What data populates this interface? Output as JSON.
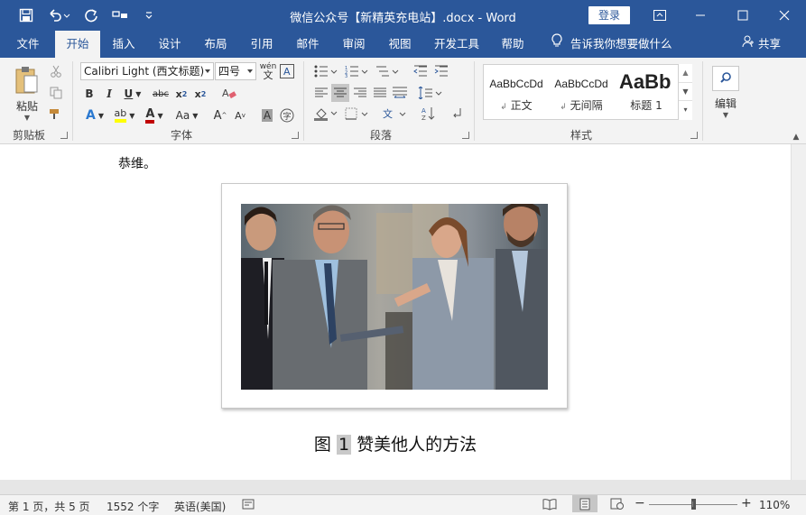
{
  "titlebar": {
    "title": "微信公众号【新精英充电站】.docx - Word",
    "login": "登录",
    "qat_icons": [
      "save-icon",
      "undo-icon",
      "redo-icon",
      "touch-mode-icon",
      "customize-icon"
    ]
  },
  "tabs": [
    {
      "label": "文件"
    },
    {
      "label": "开始",
      "active": true
    },
    {
      "label": "插入"
    },
    {
      "label": "设计"
    },
    {
      "label": "布局"
    },
    {
      "label": "引用"
    },
    {
      "label": "邮件"
    },
    {
      "label": "审阅"
    },
    {
      "label": "视图"
    },
    {
      "label": "开发工具"
    },
    {
      "label": "帮助"
    }
  ],
  "tellme": "告诉我你想要做什么",
  "share": "共享",
  "ribbon": {
    "clipboard": {
      "paste": "粘贴",
      "label": "剪贴板"
    },
    "font": {
      "font_name": "Calibri Light (西文标题)",
      "font_size": "四号",
      "phonetic": "wén",
      "label": "字体"
    },
    "paragraph": {
      "label": "段落"
    },
    "styles": {
      "items": [
        {
          "sample": "AaBbCcDd",
          "name": "正文"
        },
        {
          "sample": "AaBbCcDd",
          "name": "无间隔"
        },
        {
          "sample": "AaBb",
          "name": "标题 1"
        }
      ],
      "label": "样式"
    },
    "editing": {
      "label": "编辑"
    }
  },
  "document": {
    "text": "恭维。",
    "caption_prefix": "图",
    "caption_number": "1",
    "caption_text": "赞美他人的方法"
  },
  "statusbar": {
    "page": "第 1 页，共 5 页",
    "words": "1552 个字",
    "language": "英语(美国)",
    "zoom": "110%",
    "zoom_level": 1.1
  },
  "colors": {
    "accent": "#2b579a",
    "ribbon_bg": "#f3f3f3"
  }
}
